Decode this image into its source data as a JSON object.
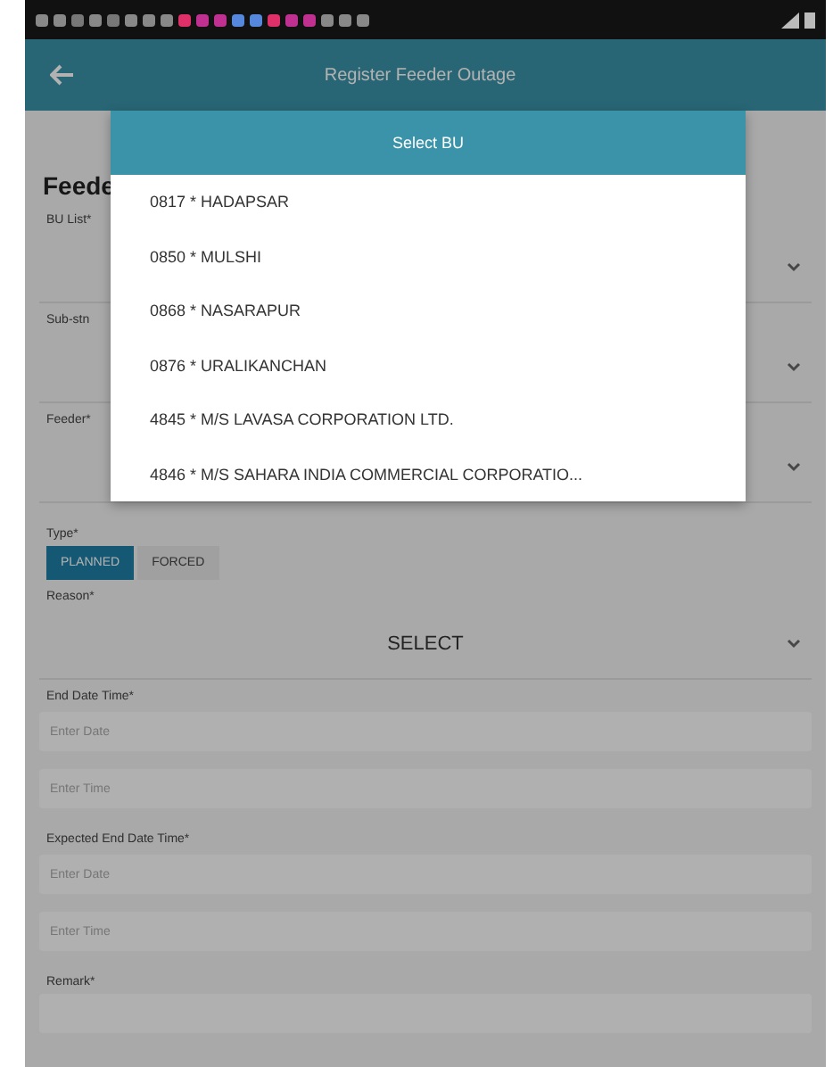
{
  "app_bar": {
    "title": "Register Feeder Outage"
  },
  "form": {
    "heading": "Feede",
    "selects": [
      {
        "label": "BU List*"
      },
      {
        "label": "Sub-stn"
      },
      {
        "label": "Feeder*"
      }
    ],
    "type": {
      "label": "Type*",
      "options": [
        {
          "label": "PLANNED",
          "selected": true
        },
        {
          "label": "FORCED",
          "selected": false
        }
      ]
    },
    "reason": {
      "label": "Reason*",
      "value": "SELECT"
    },
    "start": {
      "label": "End Date Time*",
      "date_placeholder": "Enter Date",
      "time_placeholder": "Enter Time"
    },
    "expected": {
      "label": "Expected End Date Time*",
      "date_placeholder": "Enter Date",
      "time_placeholder": "Enter Time"
    },
    "remark": {
      "label": "Remark*"
    }
  },
  "dialog": {
    "title": "Select BU",
    "items": [
      {
        "label": "0817 * HADAPSAR"
      },
      {
        "label": "0850 * MULSHI"
      },
      {
        "label": "0868 * NASARAPUR"
      },
      {
        "label": "0876 * URALIKANCHAN"
      },
      {
        "label": "4845 * M/S LAVASA CORPORATION LTD."
      },
      {
        "label": "4846 * M/S SAHARA INDIA COMMERCIAL CORPORATIO..."
      }
    ]
  }
}
